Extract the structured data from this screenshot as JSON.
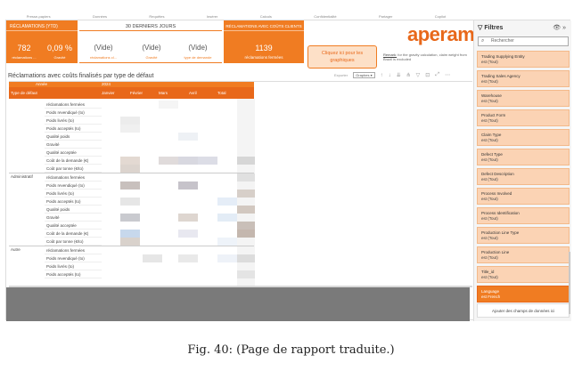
{
  "ribbon": [
    "Presse-papiers",
    "Données",
    "Requêtes",
    "Insérer",
    "Calculs",
    "Confidentialité",
    "Partager",
    "Copilot"
  ],
  "kpi_left": {
    "header": "RÉCLAMATIONS (YTD)",
    "value1": "782",
    "label1": "réclamations ...",
    "value2": "0,09 %",
    "label2": "Gravité"
  },
  "kpi_mid": {
    "header": "30 DERNIERS JOURS",
    "value1": "(Vide)",
    "label1": "réclamations cl...",
    "value2": "(Vide)",
    "label2": "Gravité",
    "value3": "(Vide)",
    "label3": "type de demande"
  },
  "kpi_right": {
    "header": "RÉCLAMATIONS AVEC COÛTS CLIENTS",
    "value": "1139",
    "label": "réclamations fermées"
  },
  "cta": {
    "line1": "Cliquez ici pour les",
    "line2": "graphiques"
  },
  "logo": "aperam",
  "remark": {
    "label": "Remark:",
    "text": " for the gravity calculation, claim weight from Brazil is excluded"
  },
  "visual": {
    "title": "Réclamations avec coûts finalisés par type de défaut",
    "export_label": "Exporter",
    "export_value": "Graphes ▾",
    "header_row1": {
      "col1": "Année",
      "col2": "2024"
    },
    "header_row2": [
      "Type de défaut",
      "Janvier",
      "Février",
      "Mars",
      "Avril",
      "Total"
    ],
    "categories": [
      "Administratif",
      "Autre"
    ],
    "metrics": [
      "réclamations fermées",
      "Poids revendiqué (to)",
      "Poids livrés (to)",
      "Poids acceptés (to)",
      "Qualité poids",
      "Gravité",
      "Qualité acceptée",
      "Coût de la demande (€)",
      "Coût par tonne (€/to)"
    ]
  },
  "filters": {
    "title": "Filtres",
    "search_placeholder": "Rechercher",
    "cards": [
      {
        "name": "Trading Supplying Entity",
        "value": "est (Tout)"
      },
      {
        "name": "Trading Sales Agency",
        "value": "est (Tout)"
      },
      {
        "name": "Warehouse",
        "value": "est (Tout)"
      },
      {
        "name": "Product Form",
        "value": "est (Tout)"
      },
      {
        "name": "Claim Type",
        "value": "est (Tout)"
      },
      {
        "name": "Defect Type",
        "value": "est (Tout)"
      },
      {
        "name": "Defect Description",
        "value": "est (Tout)"
      },
      {
        "name": "Process Involved",
        "value": "est (Tout)"
      },
      {
        "name": "Process Identification",
        "value": "est (Tout)"
      },
      {
        "name": "Production Line Type",
        "value": "est (Tout)"
      },
      {
        "name": "Production Line",
        "value": "est (Tout)"
      },
      {
        "name": "Title_id",
        "value": "est (Tout)"
      },
      {
        "name": "Language",
        "value": "est French"
      }
    ],
    "add_fields": "Ajouter des champs de données ici"
  },
  "caption": "Fig. 40: (Page de rapport traduite.)"
}
